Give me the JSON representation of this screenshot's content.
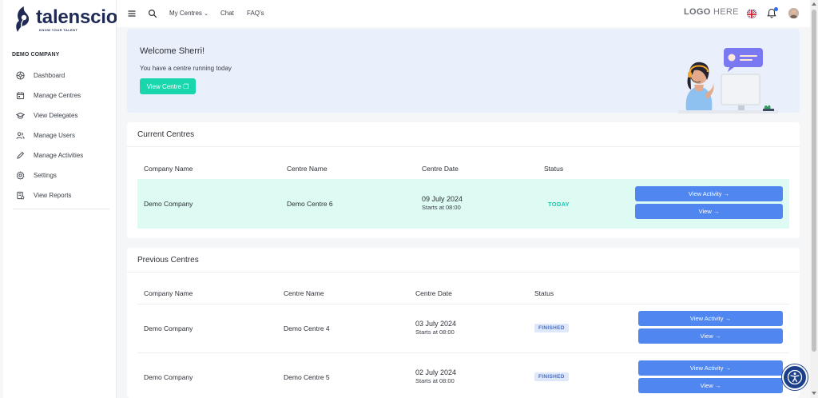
{
  "brand": {
    "name": "talenscio",
    "tagline": "KNOW YOUR TALENT",
    "color": "#1f2a56"
  },
  "sidebar": {
    "company": "DEMO COMPANY",
    "items": [
      {
        "label": "Dashboard",
        "icon": "dashboard-icon"
      },
      {
        "label": "Manage Centres",
        "icon": "calendar-icon"
      },
      {
        "label": "View Delegates",
        "icon": "graduation-cap-icon"
      },
      {
        "label": "Manage Users",
        "icon": "users-icon"
      },
      {
        "label": "Manage Activities",
        "icon": "pencil-icon"
      },
      {
        "label": "Settings",
        "icon": "gear-icon"
      },
      {
        "label": "View Reports",
        "icon": "report-icon"
      }
    ]
  },
  "topbar": {
    "menu_icon": "hamburger-icon",
    "search_icon": "search-icon",
    "links": [
      "My Centres",
      "Chat",
      "FAQ's"
    ],
    "logo_placeholder_bold": "LOGO",
    "logo_placeholder_rest": " HERE",
    "language_icon": "uk-flag-icon",
    "notification_icon": "bell-icon",
    "avatar_icon": "user-avatar"
  },
  "welcome": {
    "heading": "Welcome Sherri!",
    "message": "You have a centre running today",
    "button": "View Centre ❐"
  },
  "current_centres": {
    "title": "Current Centres",
    "columns": [
      "Company Name",
      "Centre Name",
      "Centre Date",
      "Status"
    ],
    "rows": [
      {
        "company": "Demo Company",
        "centre": "Demo Centre 6",
        "date": "09 July 2024",
        "start": "Starts at 08:00",
        "status": "TODAY",
        "action_primary": "View Activity →",
        "action_secondary": "View →"
      }
    ]
  },
  "previous_centres": {
    "title": "Previous Centres",
    "columns": [
      "Company Name",
      "Centre Name",
      "Centre Date",
      "Status"
    ],
    "rows": [
      {
        "company": "Demo Company",
        "centre": "Demo Centre 4",
        "date": "03 July 2024",
        "start": "Starts at 08:00",
        "status": "FINISHED",
        "action_primary": "View Activity →",
        "action_secondary": "View →"
      },
      {
        "company": "Demo Company",
        "centre": "Demo Centre 5",
        "date": "02 July 2024",
        "start": "Starts at 08:00",
        "status": "FINISHED",
        "action_primary": "View Activity →",
        "action_secondary": "View →"
      }
    ]
  },
  "colors": {
    "accent_teal": "#19d6ad",
    "button_blue": "#4f86f0",
    "welcome_bg": "#e9f0fb",
    "highlight_row": "#ddfaf3",
    "accessibility": "#1c3f8a"
  },
  "accessibility_icon": "accessibility-icon"
}
